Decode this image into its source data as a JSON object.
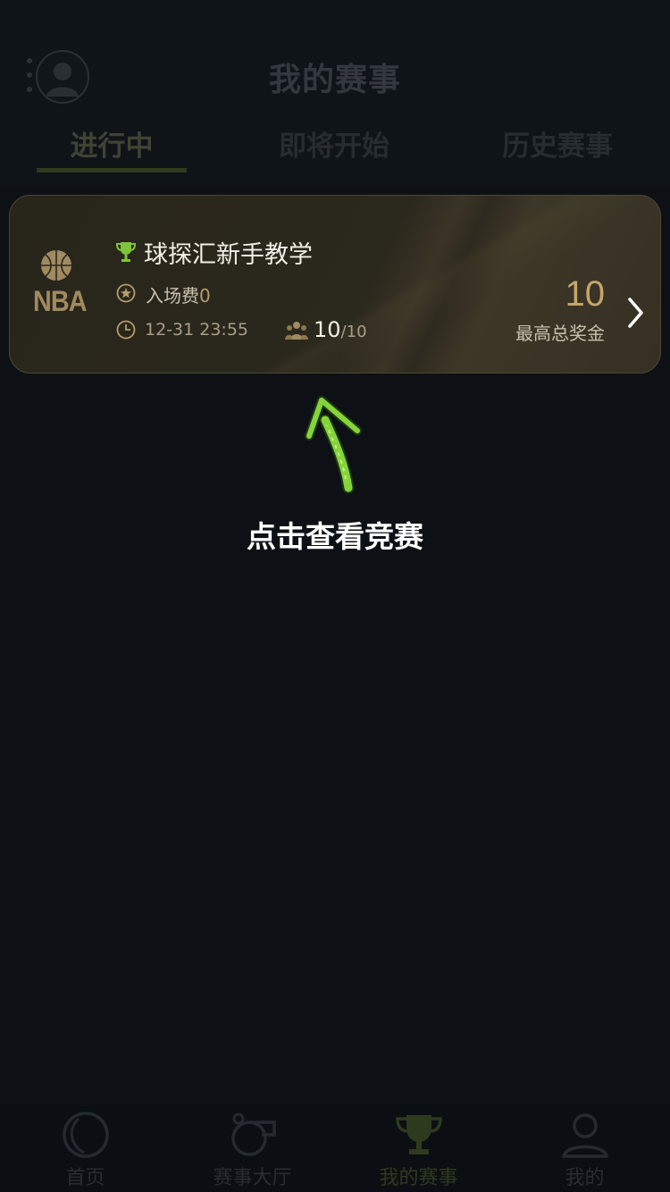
{
  "header": {
    "title": "我的赛事",
    "tabs": [
      {
        "label": "进行中",
        "active": true
      },
      {
        "label": "即将开始",
        "active": false
      },
      {
        "label": "历史赛事",
        "active": false
      }
    ]
  },
  "match_card": {
    "league": "NBA",
    "name": "球探汇新手教学",
    "fee_label": "入场费",
    "fee_value": "0",
    "time": "12-31 23:55",
    "players_current": "10",
    "players_total": "/10",
    "prize_value": "10",
    "prize_label": "最高总奖金"
  },
  "guide": {
    "text": "点击查看竞赛"
  },
  "tabbar": {
    "items": [
      {
        "label": "首页",
        "icon": "home-icon",
        "active": false
      },
      {
        "label": "赛事大厅",
        "icon": "whistle-icon",
        "active": false
      },
      {
        "label": "我的赛事",
        "icon": "trophy-icon",
        "active": true
      },
      {
        "label": "我的",
        "icon": "user-icon",
        "active": false
      }
    ]
  },
  "colors": {
    "accent_gold": "#c6a56a",
    "accent_green": "#7fc43a",
    "card_border": "#4c4632"
  }
}
